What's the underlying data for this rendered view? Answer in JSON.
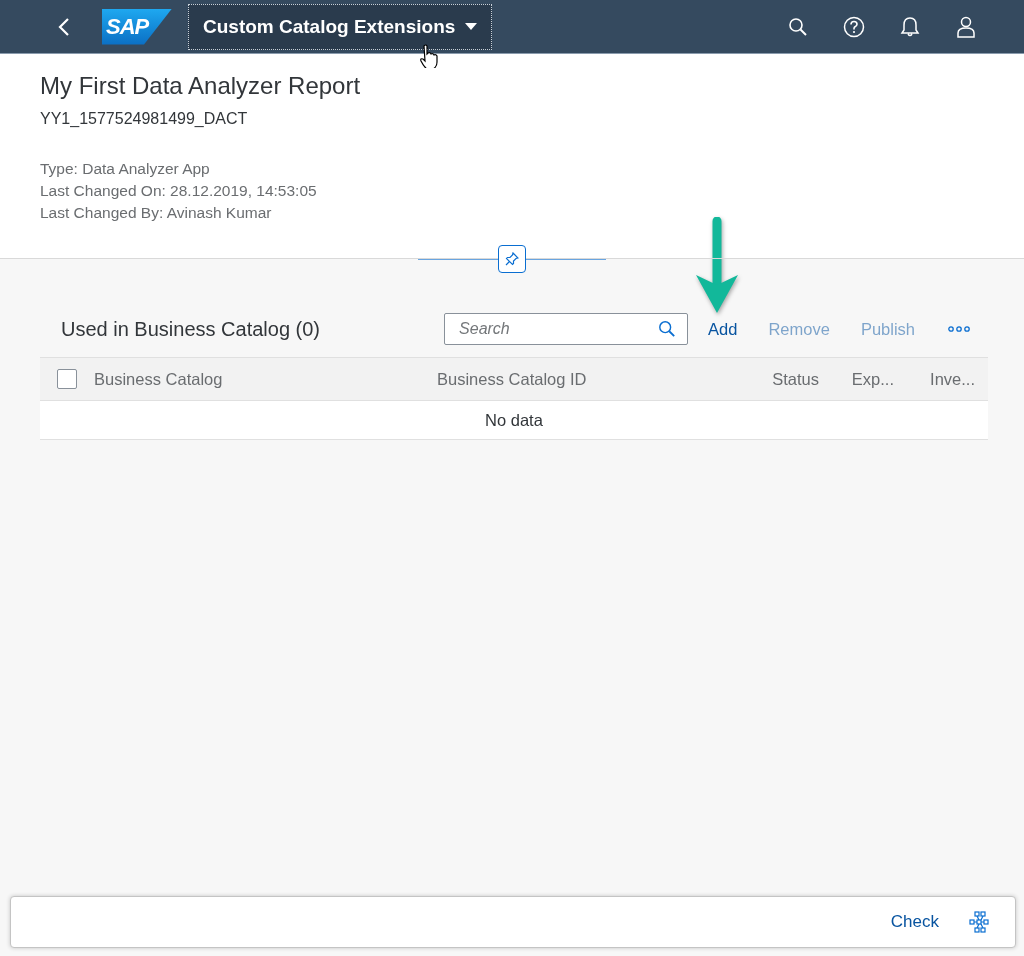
{
  "shell": {
    "logo": "SAP",
    "app_title": "Custom Catalog Extensions"
  },
  "header": {
    "title": "My First Data Analyzer Report",
    "subtitle": "YY1_1577524981499_DACT",
    "attributes": [
      "Type: Data Analyzer App",
      "Last Changed On: 28.12.2019, 14:53:05",
      "Last Changed By: Avinash Kumar"
    ]
  },
  "table": {
    "title": "Used in Business Catalog (0)",
    "search": {
      "placeholder": "Search"
    },
    "actions": [
      {
        "label": "Add",
        "disabled": false
      },
      {
        "label": "Remove",
        "disabled": true
      },
      {
        "label": "Publish",
        "disabled": true
      }
    ],
    "select_all": {
      "checked": false
    },
    "columns": [
      "Business Catalog",
      "Business Catalog ID",
      "Status",
      "Exp...",
      "Inve..."
    ],
    "empty_text": "No data"
  },
  "footer": {
    "buttons": [
      "Check"
    ]
  }
}
